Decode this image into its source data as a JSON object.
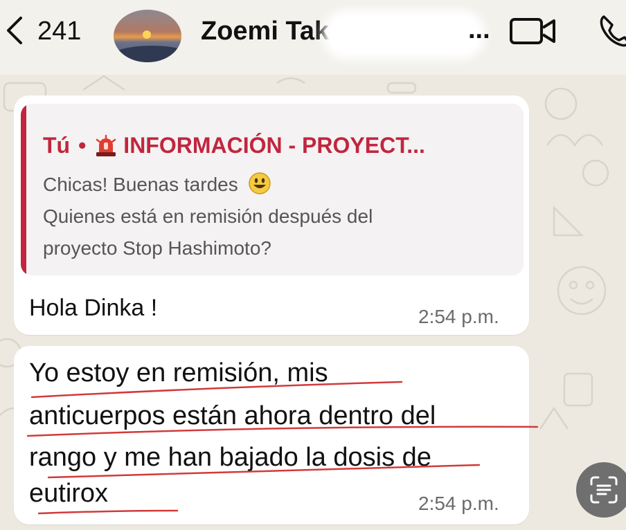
{
  "header": {
    "back_count": "241",
    "contact_name": "Zoemi Tak",
    "name_ellipsis": "..."
  },
  "quoted_message": {
    "sender": "Tú",
    "separator": "•",
    "title": "INFORMACIÓN - PROYECT...",
    "lines": [
      "Chicas! Buenas tardes",
      "Quienes está en remisión después del",
      "proyecto Stop Hashimoto?"
    ]
  },
  "messages": [
    {
      "text": "Hola Dinka !",
      "time": "2:54 p.m."
    },
    {
      "lines": [
        "Yo estoy en remisión, mis",
        "anticuerpos están ahora dentro del",
        "rango y me han bajado la dosis de",
        "eutirox"
      ],
      "time": "2:54 p.m."
    }
  ],
  "colors": {
    "accent": "#c0263f",
    "annotation": "#d23a3a",
    "background": "#ede9e1"
  }
}
